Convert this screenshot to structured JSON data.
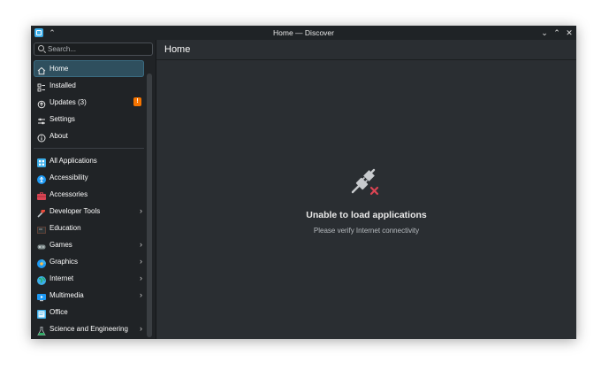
{
  "window": {
    "title": "Home — Discover"
  },
  "search": {
    "placeholder": "Search..."
  },
  "nav": {
    "primary": [
      {
        "label": "Home",
        "icon": "home-icon",
        "active": true
      },
      {
        "label": "Installed",
        "icon": "installed-icon"
      },
      {
        "label": "Updates (3)",
        "icon": "updates-icon",
        "badge": "!"
      },
      {
        "label": "Settings",
        "icon": "settings-icon"
      },
      {
        "label": "About",
        "icon": "about-icon"
      }
    ],
    "categories": [
      {
        "label": "All Applications",
        "icon": "all-applications-icon",
        "expandable": false
      },
      {
        "label": "Accessibility",
        "icon": "accessibility-icon",
        "expandable": false
      },
      {
        "label": "Accessories",
        "icon": "accessories-icon",
        "expandable": false
      },
      {
        "label": "Developer Tools",
        "icon": "developer-tools-icon",
        "expandable": true
      },
      {
        "label": "Education",
        "icon": "education-icon",
        "expandable": false
      },
      {
        "label": "Games",
        "icon": "games-icon",
        "expandable": true
      },
      {
        "label": "Graphics",
        "icon": "graphics-icon",
        "expandable": true
      },
      {
        "label": "Internet",
        "icon": "internet-icon",
        "expandable": true
      },
      {
        "label": "Multimedia",
        "icon": "multimedia-icon",
        "expandable": true
      },
      {
        "label": "Office",
        "icon": "office-icon",
        "expandable": false
      },
      {
        "label": "Science and Engineering",
        "icon": "science-icon",
        "expandable": true
      }
    ]
  },
  "page": {
    "title": "Home",
    "empty_title": "Unable to load applications",
    "empty_subtitle": "Please verify Internet connectivity"
  },
  "colors": {
    "accent": "#3daee9",
    "badge": "#f67400",
    "error": "#da4453"
  }
}
